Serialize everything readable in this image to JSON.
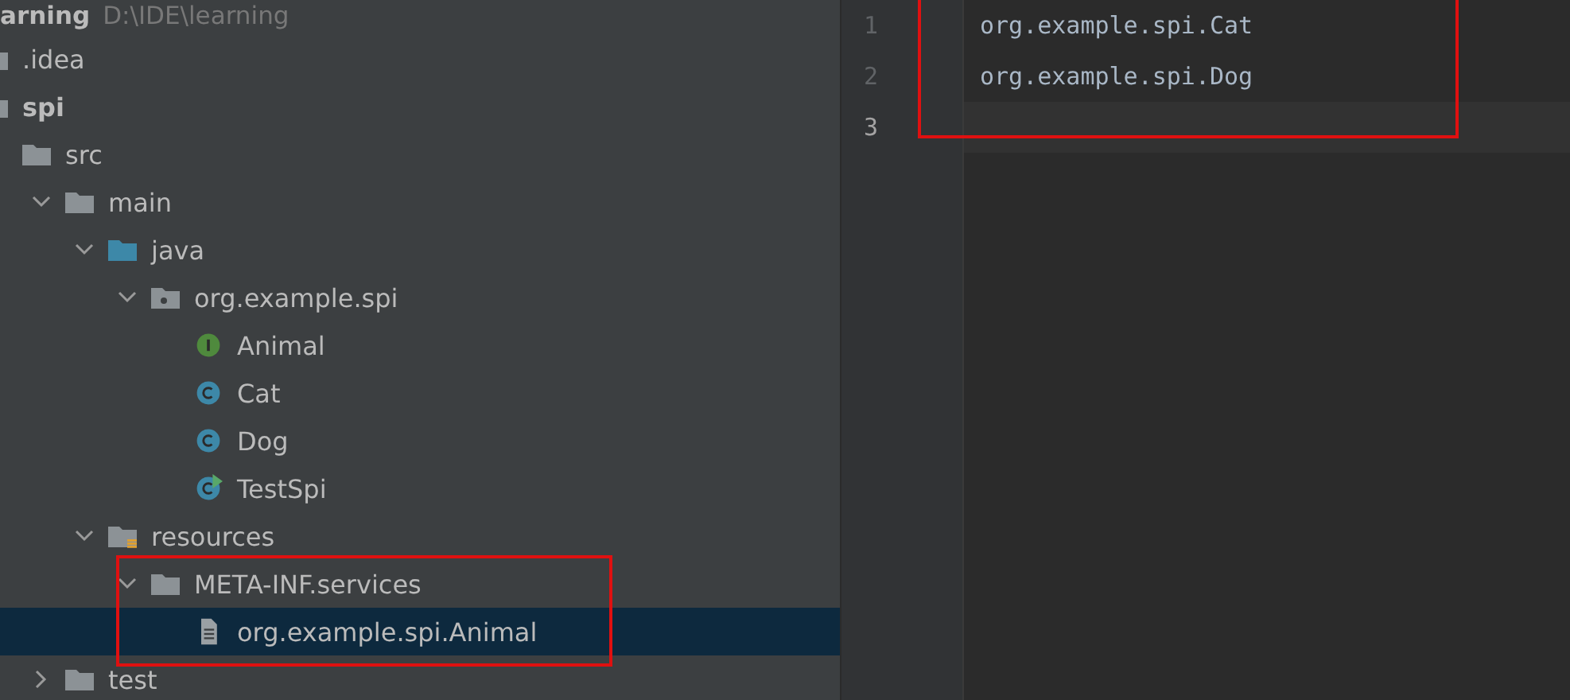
{
  "project": {
    "name": "arning",
    "path": "D:\\IDE\\learning"
  },
  "tree": [
    {
      "label": ".idea",
      "kind": "folder",
      "selected": false
    },
    {
      "label": "spi",
      "kind": "module",
      "selected": false,
      "children": [
        {
          "label": "src",
          "kind": "folder",
          "selected": false,
          "children": [
            {
              "label": "main",
              "kind": "folder",
              "expanded": true,
              "selected": false,
              "children": [
                {
                  "label": "java",
                  "kind": "source-folder",
                  "expanded": true,
                  "selected": false,
                  "children": [
                    {
                      "label": "org.example.spi",
                      "kind": "package",
                      "expanded": true,
                      "selected": false,
                      "children": [
                        {
                          "label": "Animal",
                          "kind": "interface",
                          "selected": false
                        },
                        {
                          "label": "Cat",
                          "kind": "class",
                          "selected": false
                        },
                        {
                          "label": "Dog",
                          "kind": "class",
                          "selected": false
                        },
                        {
                          "label": "TestSpi",
                          "kind": "runnable-class",
                          "selected": false
                        }
                      ]
                    }
                  ]
                },
                {
                  "label": "resources",
                  "kind": "resources",
                  "expanded": true,
                  "selected": false,
                  "children": [
                    {
                      "label": "META-INF.services",
                      "kind": "folder",
                      "expanded": true,
                      "selected": false,
                      "children": [
                        {
                          "label": "org.example.spi.Animal",
                          "kind": "file",
                          "selected": true
                        }
                      ]
                    }
                  ]
                }
              ]
            },
            {
              "label": "test",
              "kind": "folder",
              "expanded": false,
              "selected": false
            }
          ]
        }
      ]
    }
  ],
  "editor": {
    "lines": [
      {
        "number": "1",
        "text": "org.example.spi.Cat",
        "current": false
      },
      {
        "number": "2",
        "text": "org.example.spi.Dog",
        "current": false
      },
      {
        "number": "3",
        "current": true
      }
    ]
  }
}
